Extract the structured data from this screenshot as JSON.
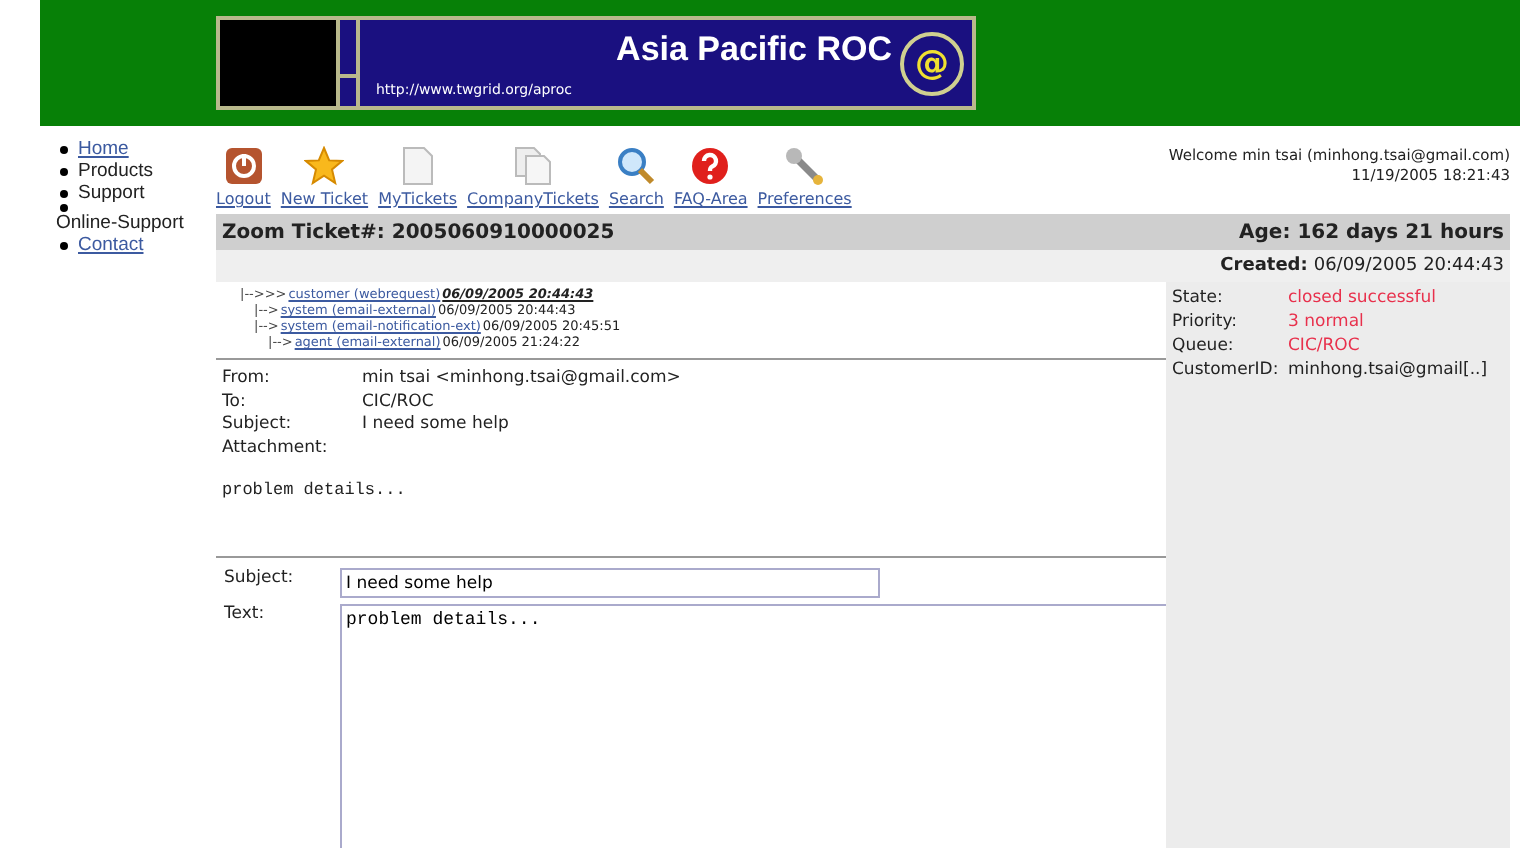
{
  "banner": {
    "title": "Asia Pacific ROC",
    "url": "http://www.twgrid.org/aproc",
    "badge": "@"
  },
  "nav": [
    {
      "label": "Home",
      "kind": "link"
    },
    {
      "label": "Products",
      "kind": "text"
    },
    {
      "label": "Support",
      "kind": "text"
    },
    {
      "label": "Online-Support",
      "kind": "text"
    },
    {
      "label": "Contact",
      "kind": "link"
    }
  ],
  "toolbar": [
    {
      "label": "Logout",
      "kind": "power"
    },
    {
      "label": "New Ticket",
      "kind": "star"
    },
    {
      "label": "MyTickets",
      "kind": "page"
    },
    {
      "label": "CompanyTickets",
      "kind": "pages"
    },
    {
      "label": "Search",
      "kind": "magnifier"
    },
    {
      "label": "FAQ-Area",
      "kind": "question"
    },
    {
      "label": "Preferences",
      "kind": "wrench"
    }
  ],
  "welcome": "Welcome min tsai (minhong.tsai@gmail.com)",
  "datetime": "11/19/2005 18:21:43",
  "ticket": {
    "title": "Zoom Ticket#: 2005060910000025",
    "age": "Age: 162 days 21 hours",
    "created_label": "Created:",
    "created": "06/09/2005 20:44:43"
  },
  "thread": [
    {
      "prefix": "|-->>>",
      "link": "customer (webrequest)",
      "time": "06/09/2005 20:44:43",
      "selected": true,
      "children": [
        {
          "prefix": "|-->",
          "link": "system (email-external)",
          "time": "06/09/2005 20:44:43",
          "selected": false
        },
        {
          "prefix": "|-->",
          "link": "system (email-notification-ext)",
          "time": "06/09/2005 20:45:51",
          "selected": false,
          "children": [
            {
              "prefix": "|-->",
              "link": "agent (email-external)",
              "time": "06/09/2005 21:24:22",
              "selected": false
            }
          ]
        }
      ]
    }
  ],
  "headers": [
    {
      "label": "From:",
      "value": "min tsai <minhong.tsai@gmail.com>"
    },
    {
      "label": "To:",
      "value": "CIC/ROC"
    },
    {
      "label": "Subject:",
      "value": "I need some help"
    },
    {
      "label": "Attachment:"
    }
  ],
  "body": "problem details...",
  "properties": [
    {
      "label": "State:",
      "value": "closed successful",
      "kind": "highlight"
    },
    {
      "label": "Priority:",
      "value": "3 normal",
      "kind": "highlight"
    },
    {
      "label": "Queue:",
      "value": "CIC/ROC",
      "kind": "highlight"
    },
    {
      "label": "CustomerID:",
      "value": "minhong.tsai@gmail[..]",
      "kind": "plain"
    }
  ],
  "reply": {
    "subject_label": "Subject:",
    "subject": "I need some help",
    "text_label": "Text:",
    "text": "problem details..."
  }
}
